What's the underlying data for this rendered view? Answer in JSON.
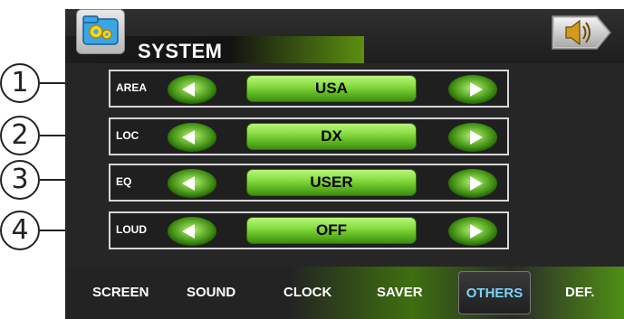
{
  "header": {
    "title": "SYSTEM",
    "icons": {
      "app": "gear-folder-icon",
      "sound": "speaker-icon"
    }
  },
  "rows": [
    {
      "callout": "1",
      "label": "AREA",
      "value": "USA"
    },
    {
      "callout": "2",
      "label": "LOC",
      "value": "DX"
    },
    {
      "callout": "3",
      "label": "EQ",
      "value": "USER"
    },
    {
      "callout": "4",
      "label": "LOUD",
      "value": "OFF"
    }
  ],
  "tabs": [
    {
      "label": "SCREEN"
    },
    {
      "label": "SOUND"
    },
    {
      "label": "CLOCK"
    },
    {
      "label": "SAVER"
    },
    {
      "label": "OTHERS",
      "active": true
    },
    {
      "label": "DEF."
    }
  ],
  "colors": {
    "accent": "#7ad3ff",
    "value_green": "#8fe048",
    "background": "#262626"
  }
}
